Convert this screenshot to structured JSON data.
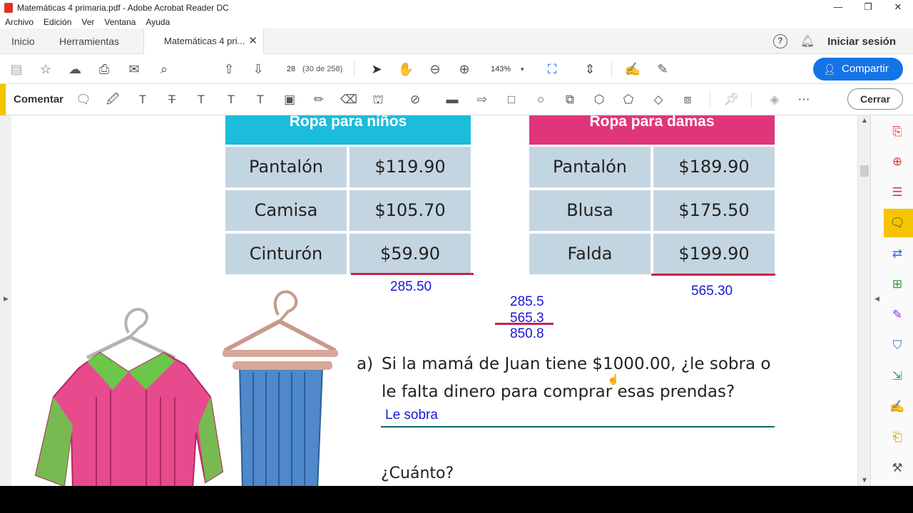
{
  "window": {
    "title": "Matemáticas 4 primaria.pdf - Adobe Acrobat Reader DC",
    "controls": [
      "—",
      "❐",
      "✕"
    ]
  },
  "menu": [
    "Archivo",
    "Edición",
    "Ver",
    "Ventana",
    "Ayuda"
  ],
  "tabs": {
    "home": "Inicio",
    "tools": "Herramientas",
    "document": "Matemáticas 4 pri...",
    "close_glyph": "✕",
    "help_glyph": "?",
    "sign_in": "Iniciar sesión"
  },
  "toolbar": {
    "page_current": "28",
    "page_of": "(30 de 258)",
    "zoom": "143%",
    "zoom_arrow": "▾",
    "share": "Compartir",
    "icons": [
      "save-icon",
      "bookmark-star-icon",
      "upload-icon",
      "print-icon",
      "email-icon",
      "search-zoom-icon",
      "page-up-icon",
      "page-down-icon",
      "select-cursor-icon",
      "hand-tool-icon",
      "zoom-out-icon",
      "zoom-in-icon",
      "fit-page-icon",
      "scroll-mode-icon",
      "sign-icon",
      "fill-sign-icon"
    ]
  },
  "comment_bar": {
    "label": "Comentar",
    "close": "Cerrar",
    "icons": [
      "sticky-note-icon",
      "highlight-pen-icon",
      "text-icon",
      "strikethrough-icon",
      "replace-text-icon",
      "insert-text-icon",
      "text-box-icon",
      "text-field-icon",
      "pencil-icon",
      "eraser-icon",
      "stamp-icon",
      "attach-icon",
      "line-icon",
      "arrow-icon",
      "rectangle-icon",
      "oval-icon",
      "callout-icon",
      "polygon-icon",
      "cloud-icon",
      "polyline-icon",
      "connected-lines-icon",
      "pin-icon",
      "fill-icon",
      "more-icon"
    ]
  },
  "document": {
    "table_kids": {
      "header": "Ropa para niños",
      "color": "#1cbcdb",
      "rows": [
        {
          "item": "Pantalón",
          "price": "$119.90"
        },
        {
          "item": "Camisa",
          "price": "$105.70"
        },
        {
          "item": "Cinturón",
          "price": "$59.90"
        }
      ]
    },
    "table_ladies": {
      "header": "Ropa para damas",
      "color": "#e0357a",
      "rows": [
        {
          "item": "Pantalón",
          "price": "$189.90"
        },
        {
          "item": "Blusa",
          "price": "$175.50"
        },
        {
          "item": "Falda",
          "price": "$199.90"
        }
      ]
    },
    "handwritten": {
      "kids_total": "285.50",
      "ladies_total": "565.30",
      "sum_line1": "285.5",
      "sum_line2": "565.3",
      "sum_result": "850.8",
      "answer": "Le sobra"
    },
    "question": {
      "letter": "a)",
      "text": "Si la mamá de Juan tiene $1000.00, ¿le sobra o le falta dinero para comprar esas prendas?",
      "followup": "¿Cuánto?"
    },
    "handwriting_color": "#1818d8",
    "rule_color": "#c4264a"
  },
  "right_panel": {
    "icons": [
      "export-pdf-icon",
      "create-pdf-icon",
      "organize-pages-icon",
      "comment-icon",
      "send-review-icon",
      "compress-icon",
      "fill-sign-icon",
      "protect-shield-icon",
      "send-track-icon",
      "edit-sign-icon",
      "export-file-icon",
      "tools-more-icon"
    ],
    "active": "comment-icon"
  }
}
